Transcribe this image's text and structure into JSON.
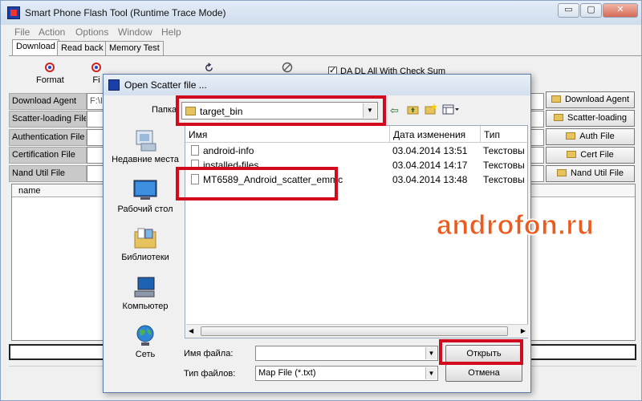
{
  "window": {
    "title": "Smart Phone Flash Tool (Runtime Trace Mode)",
    "buttons": {
      "minimize": "▭",
      "restore": "▢",
      "close": "✕"
    }
  },
  "menu": [
    "File",
    "Action",
    "Options",
    "Window",
    "Help"
  ],
  "tabs": [
    "Download",
    "Read back",
    "Memory Test"
  ],
  "toolbar": {
    "format": "Format",
    "firmware_partial": "Fi",
    "da_checkbox": "DA DL All With Check Sum"
  },
  "fields": [
    {
      "label": "Download Agent",
      "value": "F:\\I"
    },
    {
      "label": "Scatter-loading File",
      "value": ""
    },
    {
      "label": "Authentication File",
      "value": ""
    },
    {
      "label": "Certification File",
      "value": ""
    },
    {
      "label": "Nand Util File",
      "value": ""
    }
  ],
  "side_buttons": [
    "Download Agent",
    "Scatter-loading",
    "Auth File",
    "Cert File",
    "Nand Util File"
  ],
  "list_header": "name",
  "dialog": {
    "title": "Open Scatter file ...",
    "folder_label": "Папка:",
    "folder_value": "target_bin",
    "places": [
      "Недавние места",
      "Рабочий стол",
      "Библиотеки",
      "Компьютер",
      "Сеть"
    ],
    "columns": {
      "name": "Имя",
      "date": "Дата изменения",
      "type": "Тип"
    },
    "files": [
      {
        "name": "android-info",
        "date": "03.04.2014 13:51",
        "type": "Текстовы"
      },
      {
        "name": "installed-files",
        "date": "03.04.2014 14:17",
        "type": "Текстовы"
      },
      {
        "name": "MT6589_Android_scatter_emmc",
        "date": "03.04.2014 13:48",
        "type": "Текстовы"
      }
    ],
    "filename_label": "Имя файла:",
    "filename_value": "",
    "filetype_label": "Тип файлов:",
    "filetype_value": "Map File (*.txt)",
    "open_button": "Открыть",
    "cancel_button": "Отмена"
  },
  "watermark": "androfon.ru",
  "colors": {
    "highlight": "#d20a1e",
    "watermark": "#ec5a1c"
  }
}
